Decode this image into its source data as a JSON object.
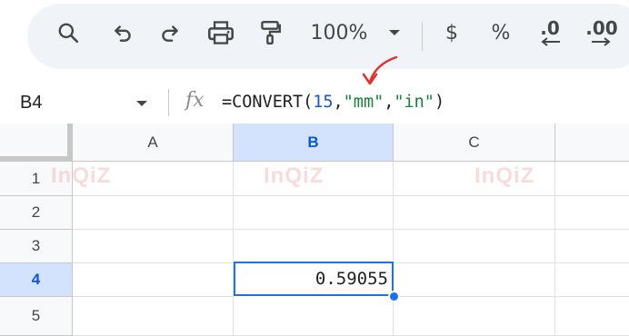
{
  "toolbar": {
    "zoom": "100%",
    "currency": "$",
    "percent": "%",
    "decrease_decimal": ".0",
    "increase_decimal": ".00"
  },
  "formula_bar": {
    "name_box": "B4",
    "fx": "fx",
    "formula_prefix": "=CONVERT(",
    "formula_num": "15",
    "formula_comma1": ",",
    "formula_from": "\"mm\"",
    "formula_comma2": ",",
    "formula_to": "\"in\"",
    "formula_close": ")"
  },
  "sheet": {
    "columns": [
      "A",
      "B",
      "C"
    ],
    "rows": [
      "1",
      "2",
      "3",
      "4",
      "5"
    ],
    "selected_cell_value": "0.59055",
    "watermark": "InQiZ"
  },
  "colors": {
    "accent": "#1a73e8",
    "number": "#1a56c4",
    "string": "#188038",
    "annotation_arrow": "#e03131"
  }
}
